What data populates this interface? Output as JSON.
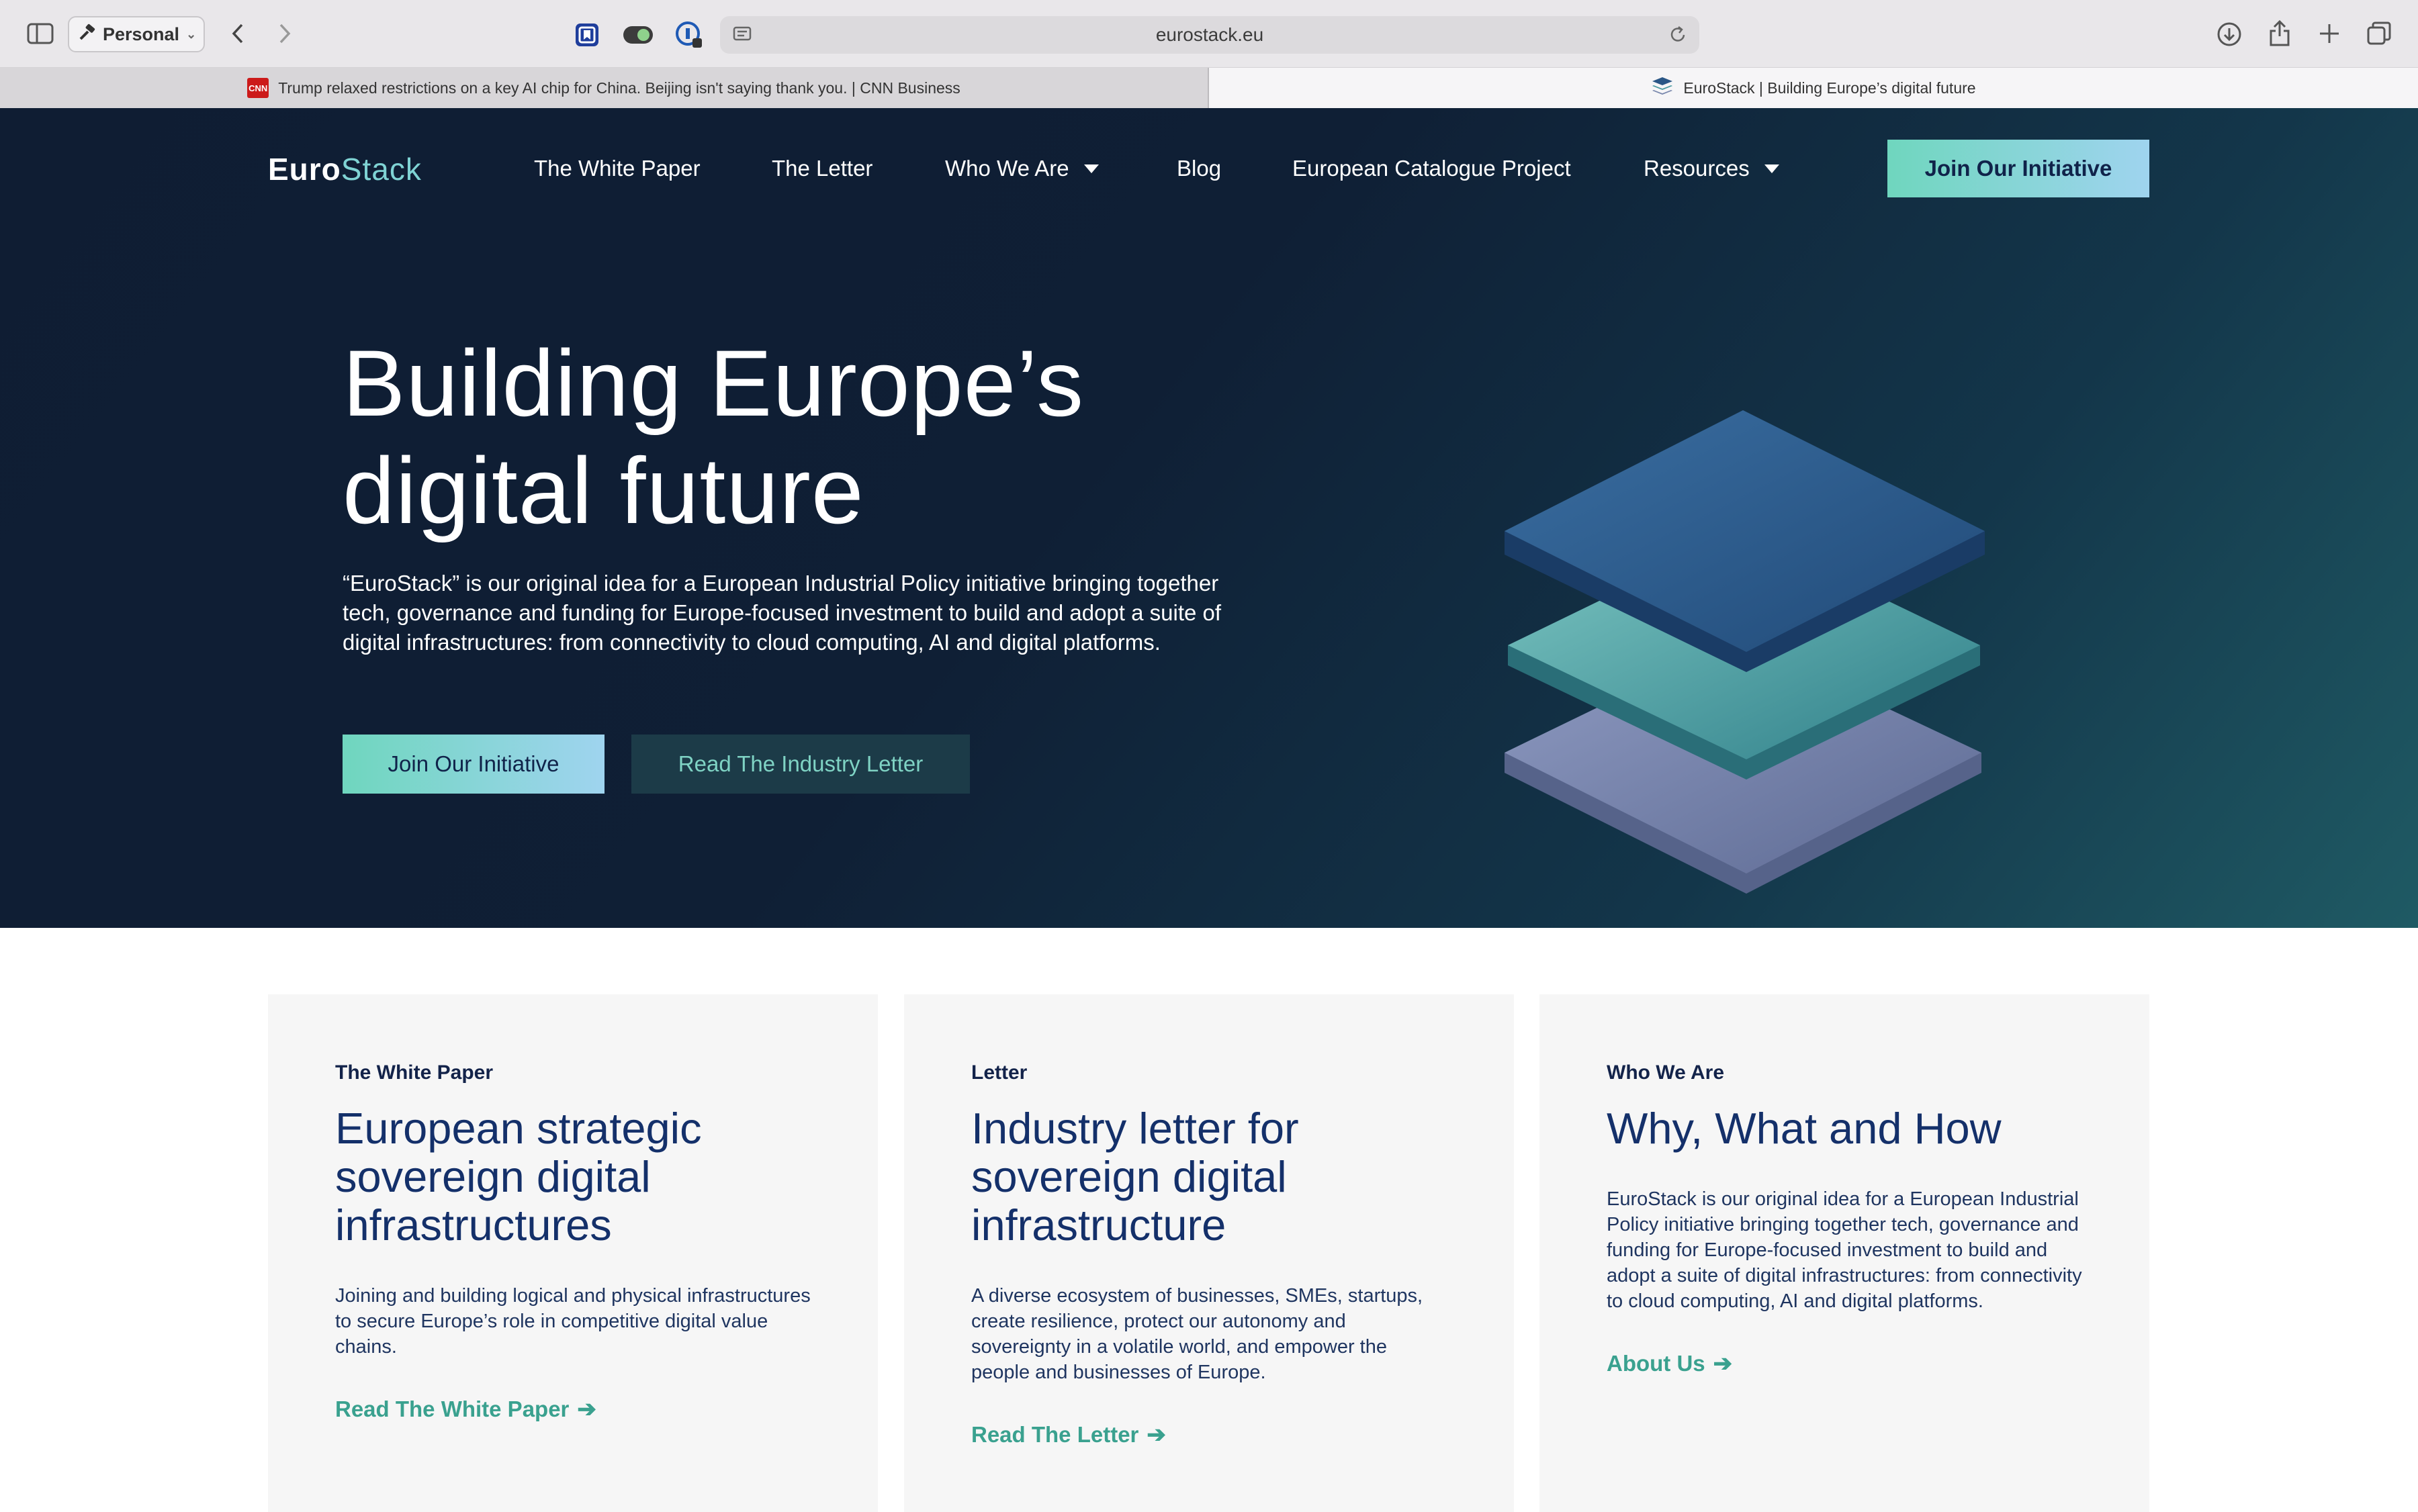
{
  "browser": {
    "profile_label": "Personal",
    "url": "eurostack.eu",
    "tabs": [
      {
        "title": "Trump relaxed restrictions on a key AI chip for China. Beijing isn't saying thank you. | CNN Business",
        "favicon": "CNN"
      },
      {
        "title": "EuroStack | Building Europe’s digital future"
      }
    ]
  },
  "nav": {
    "logo_euro": "Euro",
    "logo_stack": "Stack",
    "items": [
      "The White Paper",
      "The Letter",
      "Who We Are",
      "Blog",
      "European Catalogue Project",
      "Resources"
    ],
    "cta": "Join Our Initiative"
  },
  "hero": {
    "title_line1": "Building Europe’s",
    "title_line2": "digital future",
    "text": "“EuroStack” is our original idea for a European Industrial Policy initiative bringing together tech, governance and funding for Europe-focused investment to build and adopt a suite of digital infrastructures: from connectivity to cloud computing, AI and digital platforms.",
    "primary_button": "Join Our Initiative",
    "secondary_button": "Read The Industry Letter"
  },
  "cards": [
    {
      "eyebrow": "The White Paper",
      "title": "European strategic sovereign digital infrastructures",
      "body": "Joining and building logical and physical infrastructures to secure Europe’s role in competitive digital value chains.",
      "link": "Read The White Paper"
    },
    {
      "eyebrow": "Letter",
      "title": "Industry letter for sovereign digital infrastructure",
      "body": "A diverse ecosystem of businesses, SMEs, startups, create resilience, protect our autonomy and sovereignty in a volatile world, and empower the people and businesses of Europe.",
      "link": "Read The Letter"
    },
    {
      "eyebrow": "Who We Are",
      "title": "Why, What and How",
      "body": "EuroStack is our original idea for a European Industrial Policy initiative bringing together tech, governance and funding for Europe-focused investment to build and adopt a suite of digital infrastructures: from connectivity to cloud computing, AI and digital platforms.",
      "link": "About Us"
    }
  ],
  "colors": {
    "hero_bg": "#0f1d33",
    "accent_teal": "#3aa18f",
    "cta_gradient_start": "#6fd6be",
    "cta_gradient_end": "#9fd4ef",
    "heading_navy": "#14306a"
  }
}
